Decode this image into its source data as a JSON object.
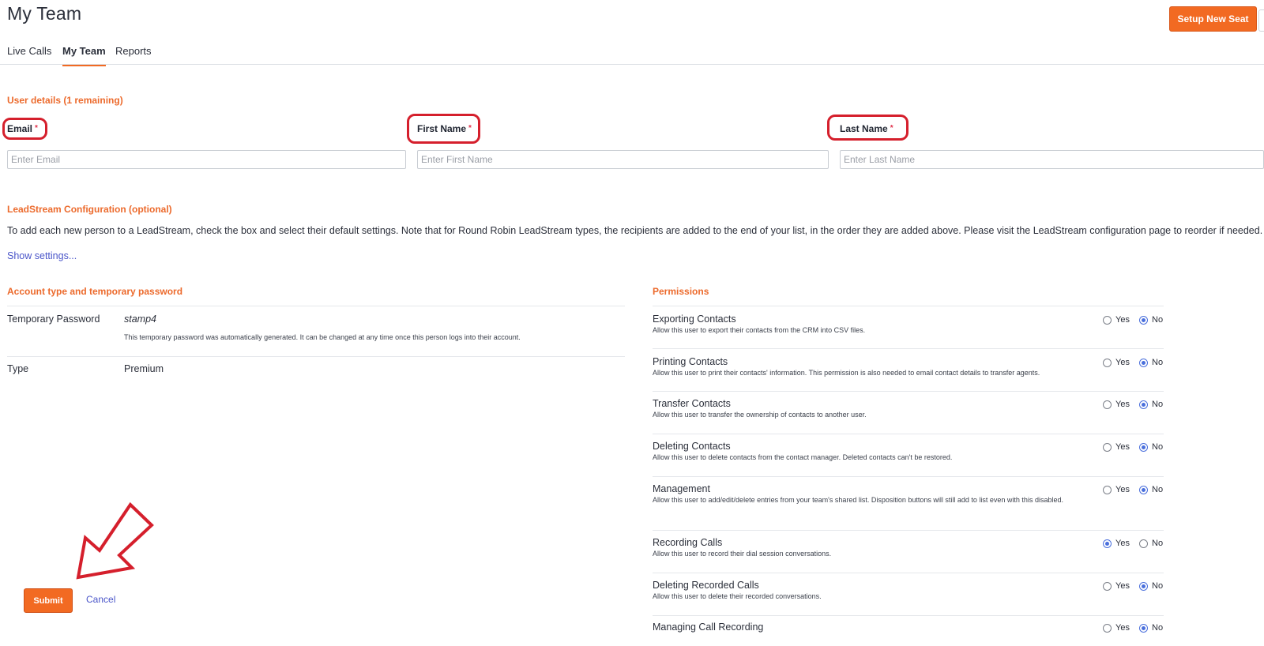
{
  "header": {
    "title": "My Team",
    "setup_button": "Setup New Seat"
  },
  "tabs": [
    {
      "label": "Live Calls"
    },
    {
      "label": "My Team",
      "active": true
    },
    {
      "label": "Reports"
    }
  ],
  "user_details": {
    "title": "User details (1 remaining)",
    "required_marker": "*",
    "email": {
      "label": "Email",
      "placeholder": "Enter Email",
      "value": ""
    },
    "first_name": {
      "label": "First Name",
      "placeholder": "Enter First Name",
      "value": ""
    },
    "last_name": {
      "label": "Last Name",
      "placeholder": "Enter Last Name",
      "value": ""
    }
  },
  "leadstream": {
    "title": "LeadStream Configuration (optional)",
    "description": "To add each new person to a LeadStream, check the box and select their default settings. Note that for Round Robin LeadStream types, the recipients are added to the end of your list, in the order they are added above. Please visit the LeadStream configuration page to reorder if needed.",
    "show_settings": "Show settings..."
  },
  "account": {
    "title": "Account type and temporary password",
    "password_label": "Temporary Password",
    "password_value": "stamp4",
    "password_note": "This temporary password was automatically generated. It can be changed at any time once this person logs into their account.",
    "type_label": "Type",
    "type_value": "Premium"
  },
  "permissions": {
    "title": "Permissions",
    "yes_label": "Yes",
    "no_label": "No",
    "items": [
      {
        "name": "Exporting Contacts",
        "desc": "Allow this user to export their contacts from the CRM into CSV files.",
        "value": "No"
      },
      {
        "name": "Printing Contacts",
        "desc": "Allow this user to print their contacts' information. This permission is also needed to email contact details to transfer agents.",
        "value": "No"
      },
      {
        "name": "Transfer Contacts",
        "desc": "Allow this user to transfer the ownership of contacts to another user.",
        "value": "No"
      },
      {
        "name": "Deleting Contacts",
        "desc": "Allow this user to delete contacts from the contact manager. Deleted contacts can't be restored.",
        "value": "No"
      },
      {
        "name": "Management",
        "desc": "Allow this user to add/edit/delete entries from your team's shared list. Disposition buttons will still add to list even with this disabled.",
        "value": "No"
      },
      {
        "name": "Recording Calls",
        "desc": "Allow this user to record their dial session conversations.",
        "value": "Yes"
      },
      {
        "name": "Deleting Recorded Calls",
        "desc": "Allow this user to delete their recorded conversations.",
        "value": "No"
      },
      {
        "name": "Managing Call Recording",
        "desc": "",
        "value": "No"
      }
    ]
  },
  "actions": {
    "submit": "Submit",
    "cancel": "Cancel"
  },
  "colors": {
    "accent": "#f26a22",
    "section_title": "#ec6a2c",
    "link": "#4a55c9",
    "annotation": "#d51f2c",
    "radio_selected": "#4a6fdc"
  },
  "annotations": {
    "arrow": "red-outline-arrow-pointing-to-submit",
    "rings": [
      "email-label",
      "first-name-label",
      "last-name-label"
    ]
  }
}
